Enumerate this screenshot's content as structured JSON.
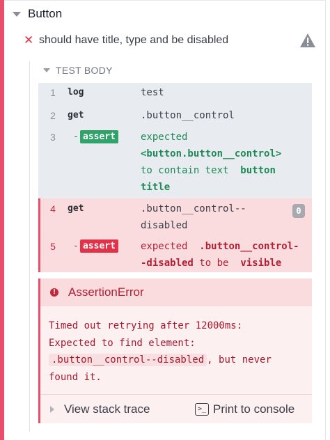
{
  "suite": {
    "title": "Button"
  },
  "test": {
    "title": "should have title, type and be disabled",
    "status": "failed"
  },
  "body": {
    "header": "TEST BODY"
  },
  "commands": [
    {
      "num": "1",
      "name": "log",
      "message": "test"
    },
    {
      "num": "2",
      "name": "get",
      "message": ".button__control"
    },
    {
      "num": "3",
      "name": "- assert",
      "badge": "assert",
      "message_parts": [
        "expected",
        "<button.button__control>",
        "to contain text",
        "button",
        "title"
      ]
    },
    {
      "num": "4",
      "name": "get",
      "message_line1": ".button__control--",
      "message_line2": "disabled",
      "count": "0"
    },
    {
      "num": "5",
      "name": "- assert",
      "badge": "assert",
      "message_parts": [
        "expected",
        ".button__control-",
        "-disabled",
        "to be",
        "visible"
      ]
    }
  ],
  "error": {
    "title": "AssertionError",
    "line1": "Timed out retrying after 12000ms:",
    "line2": "Expected to find element:",
    "code": ".button__control--disabled",
    "line3_suffix": ", but never",
    "line4": "found it.",
    "stack_label": "View stack trace",
    "console_label": "Print to console"
  },
  "colors": {
    "fail_accent": "#e94f6c",
    "pass_badge": "#2fa369",
    "fail_badge": "#e0334a"
  }
}
